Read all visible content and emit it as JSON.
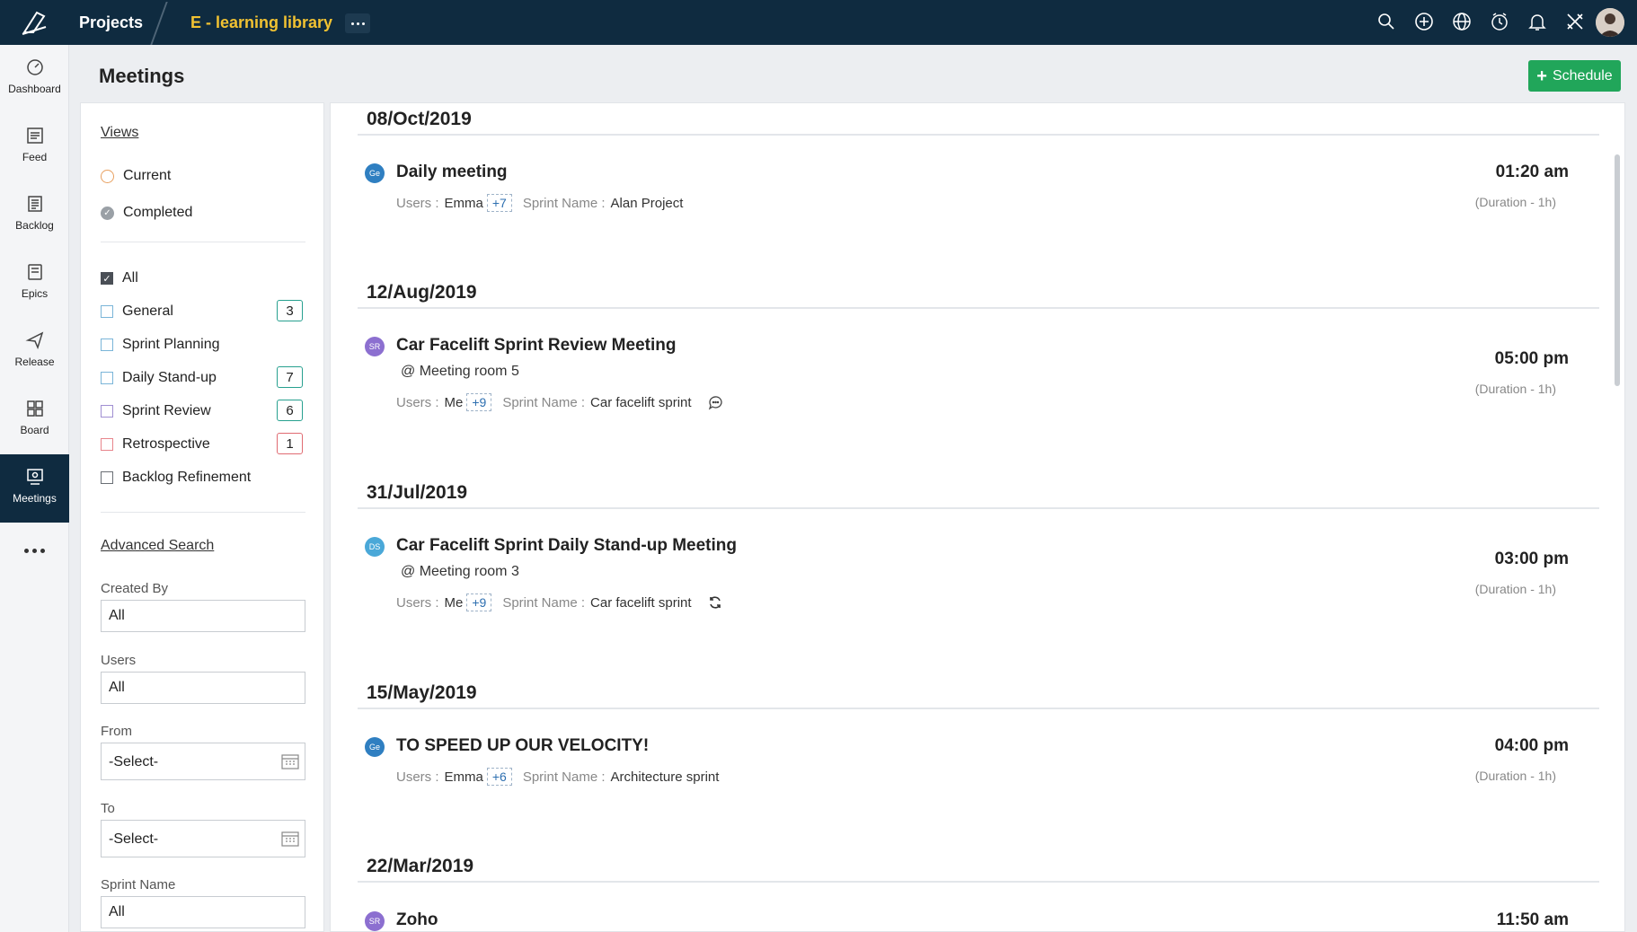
{
  "topbar": {
    "projects_label": "Projects",
    "project_name": "E - learning library",
    "icons": [
      "search-icon",
      "add-circle-icon",
      "globe-icon",
      "timer-icon",
      "bell-icon",
      "tools-icon"
    ]
  },
  "nav": {
    "items": [
      {
        "label": "Dashboard",
        "icon": "dashboard-icon"
      },
      {
        "label": "Feed",
        "icon": "feed-icon"
      },
      {
        "label": "Backlog",
        "icon": "backlog-icon"
      },
      {
        "label": "Epics",
        "icon": "epics-icon"
      },
      {
        "label": "Release",
        "icon": "release-icon"
      },
      {
        "label": "Board",
        "icon": "board-icon"
      },
      {
        "label": "Meetings",
        "icon": "meetings-icon"
      }
    ],
    "active": "Meetings"
  },
  "page": {
    "title": "Meetings",
    "schedule_label": "Schedule"
  },
  "filters": {
    "views_label": "Views",
    "view_options": [
      "Current",
      "Completed"
    ],
    "types": [
      {
        "label": "All",
        "checked": true
      },
      {
        "label": "General",
        "count": "3"
      },
      {
        "label": "Sprint Planning"
      },
      {
        "label": "Daily Stand-up",
        "count": "7"
      },
      {
        "label": "Sprint Review",
        "count": "6"
      },
      {
        "label": "Retrospective",
        "count": "1"
      },
      {
        "label": "Backlog Refinement"
      }
    ],
    "advanced_search_label": "Advanced Search",
    "created_by_label": "Created By",
    "created_by_value": "All",
    "users_label": "Users",
    "users_value": "All",
    "from_label": "From",
    "from_value": "-Select-",
    "to_label": "To",
    "to_value": "-Select-",
    "sprint_name_label": "Sprint Name",
    "sprint_name_value": "All"
  },
  "meetings": [
    {
      "date": "08/Oct/2019",
      "avatar": "Ge",
      "avatar_color": "#2f7fc1",
      "title": "Daily meeting",
      "users_label": "Users :",
      "user": "Emma",
      "more": "+7",
      "sprint_label": "Sprint Name :",
      "sprint": "Alan Project",
      "time": "01:20 am",
      "duration": "(Duration - 1h)"
    },
    {
      "date": "12/Aug/2019",
      "avatar": "SR",
      "avatar_color": "#8c6fd0",
      "title": "Car Facelift Sprint Review Meeting",
      "room": "@ Meeting room 5",
      "users_label": "Users :",
      "user": "Me",
      "more": "+9",
      "sprint_label": "Sprint Name :",
      "sprint": "Car facelift sprint",
      "extra_icon": "comment-icon",
      "time": "05:00 pm",
      "duration": "(Duration - 1h)"
    },
    {
      "date": "31/Jul/2019",
      "avatar": "DS",
      "avatar_color": "#4aa8d8",
      "title": "Car Facelift Sprint Daily Stand-up Meeting",
      "room": "@ Meeting room 3",
      "users_label": "Users :",
      "user": "Me",
      "more": "+9",
      "sprint_label": "Sprint Name :",
      "sprint": "Car facelift sprint",
      "extra_icon": "recurring-icon",
      "time": "03:00 pm",
      "duration": "(Duration - 1h)"
    },
    {
      "date": "15/May/2019",
      "avatar": "Ge",
      "avatar_color": "#2f7fc1",
      "title": "TO SPEED UP OUR VELOCITY!",
      "users_label": "Users :",
      "user": "Emma",
      "more": "+6",
      "sprint_label": "Sprint Name :",
      "sprint": "Architecture sprint",
      "time": "04:00 pm",
      "duration": "(Duration - 1h)"
    },
    {
      "date": "22/Mar/2019",
      "avatar": "SR",
      "avatar_color": "#8c6fd0",
      "title": "Zoho",
      "time": "11:50 am"
    }
  ]
}
